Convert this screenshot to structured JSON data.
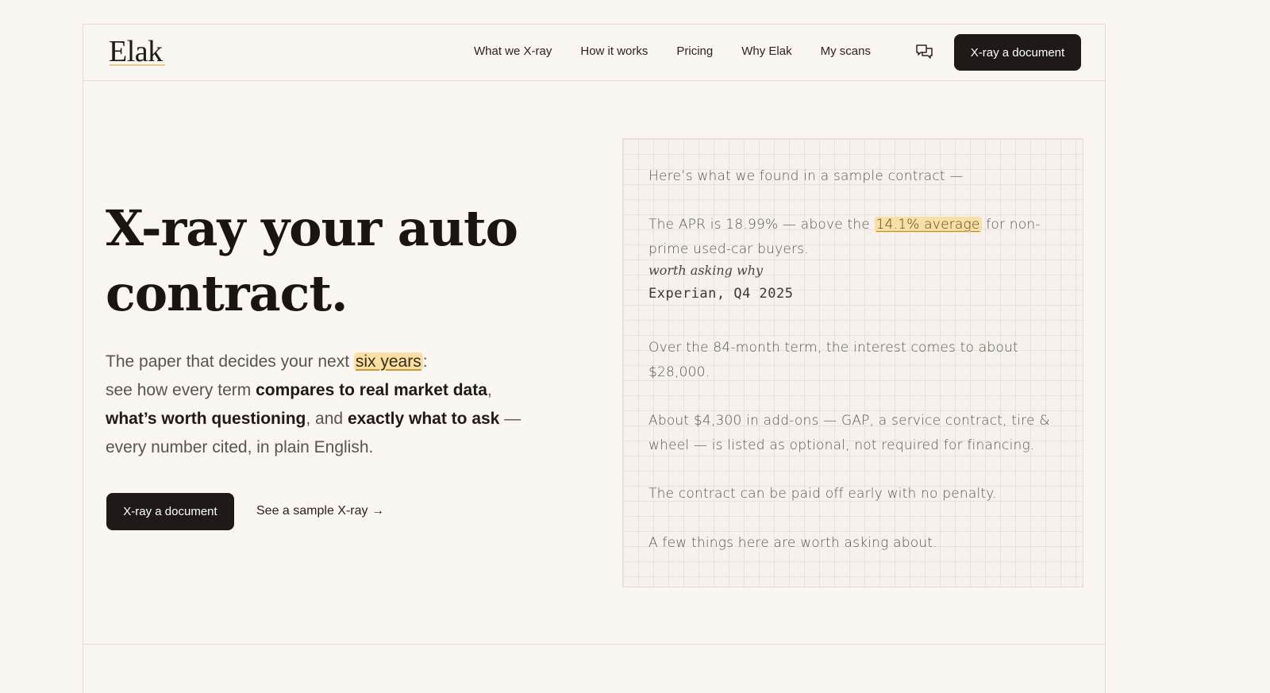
{
  "brand": {
    "logo": "Elak"
  },
  "nav": {
    "items": [
      "What we X-ray",
      "How it works",
      "Pricing",
      "Why Elak",
      "My scans"
    ],
    "cta": "X-ray a document",
    "icon": "chat-bubbles-icon"
  },
  "hero": {
    "title_line1": "X-ray your auto",
    "title_line2": "contract.",
    "sub": {
      "p1": "The paper that decides your next ",
      "highlight": "six years",
      "p2": ":",
      "p3": "see how every term ",
      "b1": "compares to real market data",
      "p4": ",",
      "b2": "what’s worth questioning",
      "p5": ", and ",
      "b3": "exactly what to ask",
      "p6": " —",
      "p7": "every number cited, in plain English."
    },
    "cta": "X-ray a document",
    "link": "See a sample X-ray →"
  },
  "sample": {
    "intro": "Here’s what we found in a sample contract —",
    "apr_pre": "The APR is 18.99% — above the ",
    "apr_hl": "14.1% average",
    "apr_post": " for non-prime used-car buyers.",
    "note": "worth asking why",
    "source": "Experian, Q4 2025",
    "interest": "Over the 84-month term, the interest comes to about $28,000.",
    "addons": "About $4,300 in add-ons — GAP, a service contract, tire & wheel — is listed as optional, not required for financing.",
    "payoff": "The contract can be paid off early with no penalty.",
    "closing": "A few things here are worth asking about."
  },
  "colors": {
    "background": "#f9f5f0",
    "ink": "#1f1a17",
    "highlight": "#f7dfa6"
  }
}
